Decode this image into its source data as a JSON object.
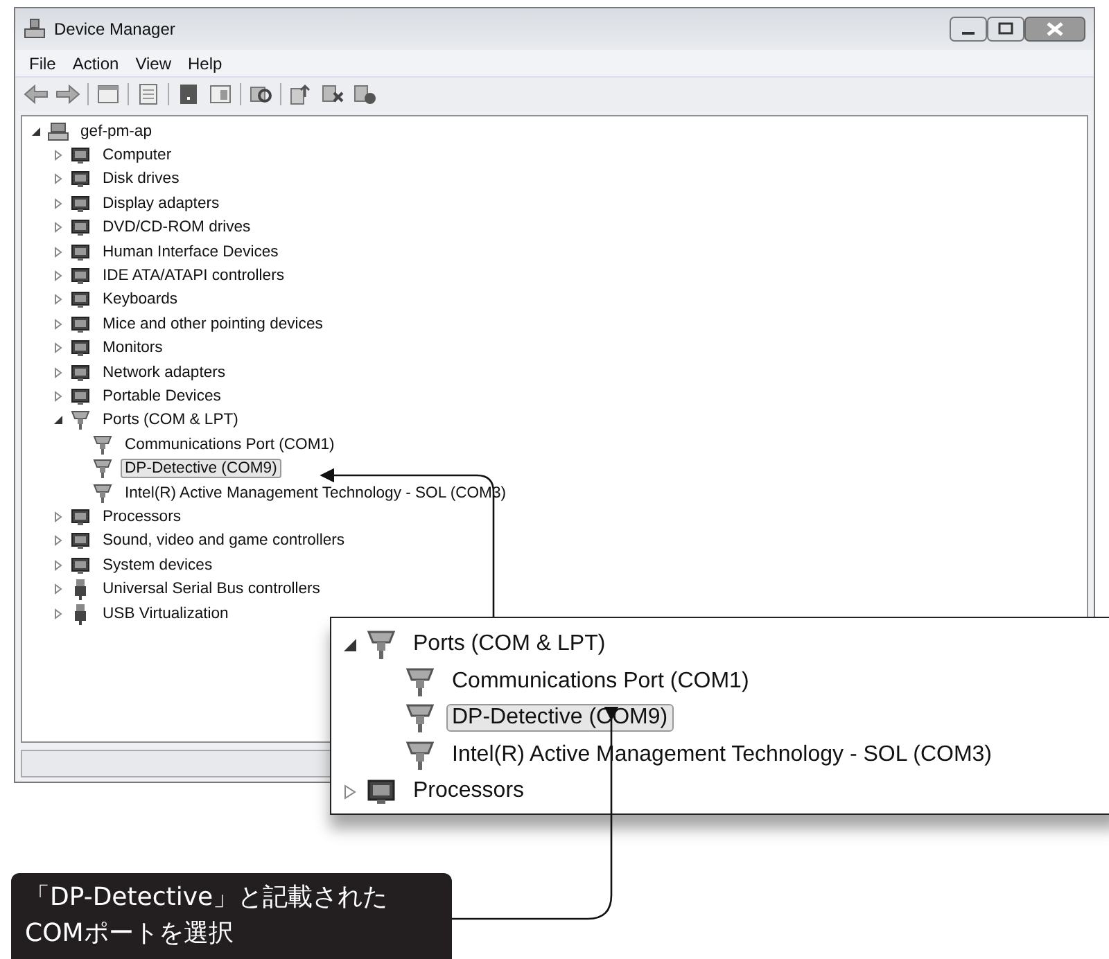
{
  "window": {
    "title": "Device Manager",
    "menu": [
      "File",
      "Action",
      "View",
      "Help"
    ],
    "tree": {
      "label": "gef-pm-ap",
      "kind": "computer",
      "expanded": true,
      "selected": false,
      "children": [
        {
          "label": "Computer",
          "kind": "device",
          "expanded": false,
          "selected": false
        },
        {
          "label": "Disk drives",
          "kind": "device",
          "expanded": false,
          "selected": false
        },
        {
          "label": "Display adapters",
          "kind": "device",
          "expanded": false,
          "selected": false
        },
        {
          "label": "DVD/CD-ROM drives",
          "kind": "device",
          "expanded": false,
          "selected": false
        },
        {
          "label": "Human Interface Devices",
          "kind": "device",
          "expanded": false,
          "selected": false
        },
        {
          "label": "IDE ATA/ATAPI controllers",
          "kind": "device",
          "expanded": false,
          "selected": false
        },
        {
          "label": "Keyboards",
          "kind": "device",
          "expanded": false,
          "selected": false
        },
        {
          "label": "Mice and other pointing devices",
          "kind": "device",
          "expanded": false,
          "selected": false
        },
        {
          "label": "Monitors",
          "kind": "device",
          "expanded": false,
          "selected": false
        },
        {
          "label": "Network adapters",
          "kind": "device",
          "expanded": false,
          "selected": false
        },
        {
          "label": "Portable Devices",
          "kind": "device",
          "expanded": false,
          "selected": false
        },
        {
          "label": "Ports (COM & LPT)",
          "kind": "port",
          "expanded": true,
          "selected": false,
          "children": [
            {
              "label": "Communications Port (COM1)",
              "kind": "port",
              "selected": false
            },
            {
              "label": "DP-Detective (COM9)",
              "kind": "port",
              "selected": true
            },
            {
              "label": "Intel(R) Active Management Technology - SOL (COM3)",
              "kind": "port",
              "selected": false
            }
          ]
        },
        {
          "label": "Processors",
          "kind": "device",
          "expanded": false,
          "selected": false
        },
        {
          "label": "Sound, video and game controllers",
          "kind": "device",
          "expanded": false,
          "selected": false
        },
        {
          "label": "System devices",
          "kind": "device",
          "expanded": false,
          "selected": false
        },
        {
          "label": "Universal Serial Bus controllers",
          "kind": "usb",
          "expanded": false,
          "selected": false
        },
        {
          "label": "USB Virtualization",
          "kind": "usb",
          "expanded": false,
          "selected": false
        }
      ]
    }
  },
  "inset": {
    "items": [
      {
        "label": "Ports (COM & LPT)",
        "kind": "port",
        "expanded": true,
        "selected": false,
        "children": [
          {
            "label": "Communications Port (COM1)",
            "kind": "port",
            "selected": false
          },
          {
            "label": "DP-Detective (COM9)",
            "kind": "port",
            "selected": true
          },
          {
            "label": "Intel(R) Active Management Technology - SOL (COM3)",
            "kind": "port",
            "selected": false
          }
        ]
      },
      {
        "label": "Processors",
        "kind": "device",
        "expanded": false,
        "selected": false
      }
    ]
  },
  "caption": "「DP-Detective」と記載された\nCOMポートを選択"
}
